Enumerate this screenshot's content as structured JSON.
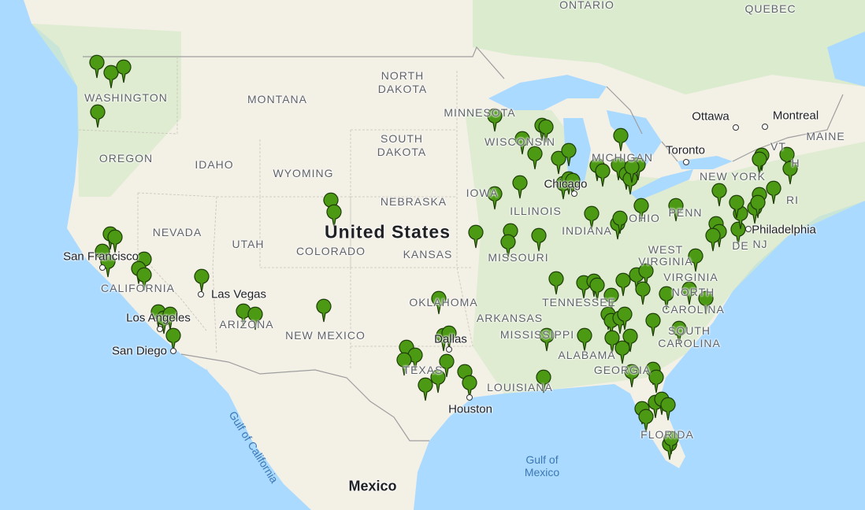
{
  "map": {
    "colors": {
      "water": "#aadaff",
      "land": "#f3f0e6",
      "park": "#cfe7c1",
      "marker": "#4c9a14",
      "marker_outline": "#1e3d08"
    },
    "marker_icon": "map-pin-icon",
    "country_labels": {
      "us": "United States",
      "mexico": "Mexico"
    },
    "region_labels": {
      "ontario": "ONTARIO",
      "quebec": "QUEBEC",
      "north_dakota": "NORTH DAKOTA",
      "montana": "MONTANA",
      "washington": "WASHINGTON",
      "minnesota": "MINNESOTA",
      "maine": "MAINE",
      "south_dakota": "SOUTH DAKOTA",
      "wisconsin": "WISCONSIN",
      "michigan": "MICHIGAN",
      "oregon": "OREGON",
      "idaho": "IDAHO",
      "wyoming": "WYOMING",
      "new_york": "NEW YORK",
      "nebraska": "NEBRASKA",
      "iowa": "IOWA",
      "vt": "VT",
      "nh": "H",
      "ri": "RI",
      "illinois": "ILLINOIS",
      "penn": "PENN",
      "nevada": "NEVADA",
      "utah": "UTAH",
      "colorado": "COLORADO",
      "kansas": "KANSAS",
      "missouri": "MISSOURI",
      "indiana": "INDIANA",
      "ohio": "OHIO",
      "nj": "NJ",
      "de": "DE",
      "west_virginia": "WEST VIRGINIA",
      "virginia": "VIRGINIA",
      "california": "CALIFORNIA",
      "oklahoma": "OKLAHOMA",
      "tennessee": "TENNESSEE",
      "north_carolina": "NORTH CAROLINA",
      "arizona": "ARIZONA",
      "new_mexico": "NEW MEXICO",
      "arkansas": "ARKANSAS",
      "mississippi": "MISSISSIPPI",
      "alabama": "ALABAMA",
      "south_carolina": "SOUTH CAROLINA",
      "texas": "TEXAS",
      "georgia": "GEORGIA",
      "louisiana": "LOUISIANA",
      "florida": "FLORIDA"
    },
    "city_labels": {
      "ottawa": "Ottawa",
      "montreal": "Montreal",
      "toronto": "Toronto",
      "chicago": "Chicago",
      "philadelphia": "Philadelphia",
      "san_francisco": "San Francisco",
      "las_vegas": "Las Vegas",
      "los_angeles": "Los Angeles",
      "san_diego": "San Diego",
      "dallas": "Dallas",
      "houston": "Houston"
    },
    "water_labels": {
      "gulf_of_california": "Gulf of California",
      "gulf_of_mexico_1": "Gulf of",
      "gulf_of_mexico_2": "Mexico"
    }
  }
}
